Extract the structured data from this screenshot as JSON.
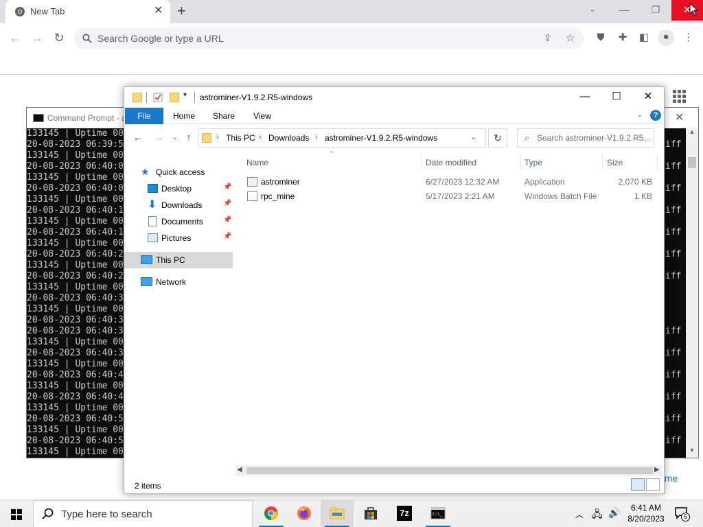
{
  "browser": {
    "tab_title": "New Tab",
    "tab_close": "✕",
    "new_tab": "+",
    "omnibox_placeholder": "Search Google or type a URL",
    "win_min": "—",
    "win_restore": "❐",
    "win_close": "✕",
    "home_link_fragment": "ome"
  },
  "cmd": {
    "title": "Command Prompt - a",
    "lines": [
      "133145 | Uptime 00",
      "20-08-2023 06:39:5",
      "133145 | Uptime 00",
      "20-08-2023 06:40:0",
      "133145 | Uptime 00",
      "20-08-2023 06:40:0",
      "133145 | Uptime 00",
      "20-08-2023 06:40:1",
      "133145 | Uptime 00",
      "20-08-2023 06:40:1",
      "133145 | Uptime 00",
      "20-08-2023 06:40:2",
      "133145 | Uptime 00",
      "20-08-2023 06:40:2",
      "133145 | Uptime 00",
      "20-08-2023 06:40:3",
      "133145 | Uptime 00",
      "20-08-2023 06:40:3",
      "20-08-2023 06:40:3",
      "133145 | Uptime 00",
      "20-08-2023 06:40:3",
      "133145 | Uptime 00",
      "20-08-2023 06:40:4",
      "133145 | Uptime 00",
      "20-08-2023 06:40:4",
      "133145 | Uptime 00",
      "20-08-2023 06:40:5",
      "133145 | Uptime 00",
      "20-08-2023 06:40:5",
      "133145 | Uptime 00"
    ],
    "right_fragments": [
      "",
      "iff",
      "",
      "iff",
      "",
      "iff",
      "",
      "iff",
      "",
      "iff",
      "",
      "iff",
      "",
      "iff",
      "",
      "",
      "",
      "",
      "iff",
      "",
      "iff",
      "",
      "iff",
      "",
      "iff",
      "",
      "iff",
      "",
      "iff"
    ]
  },
  "explorer": {
    "title": "astrominer-V1.9.2.R5-windows",
    "win_min": "—",
    "win_max": "☐",
    "win_close": "✕",
    "ribbon_tabs": [
      "File",
      "Home",
      "Share",
      "View"
    ],
    "help": "?",
    "breadcrumb": [
      "This PC",
      "Downloads",
      "astrominer-V1.9.2.R5-windows"
    ],
    "search_placeholder": "Search astrominer-V1.9.2.R5...",
    "nav": {
      "quick_access": "Quick access",
      "desktop": "Desktop",
      "downloads": "Downloads",
      "documents": "Documents",
      "pictures": "Pictures",
      "this_pc": "This PC",
      "network": "Network"
    },
    "columns": {
      "name": "Name",
      "date": "Date modified",
      "type": "Type",
      "size": "Size"
    },
    "files": [
      {
        "name": "astrominer",
        "date": "6/27/2023 12:32 AM",
        "type": "Application",
        "size": "2,070 KB"
      },
      {
        "name": "rpc_mine",
        "date": "5/17/2023 2:21 AM",
        "type": "Windows Batch File",
        "size": "1 KB"
      }
    ],
    "status_count": "2 items",
    "colors": {
      "accent": "#1979ca",
      "folder": "#f8d775"
    }
  },
  "taskbar": {
    "search_placeholder": "Type here to search",
    "time": "6:41 AM",
    "date": "8/20/2023",
    "notification_count": "5",
    "apps": [
      "chrome-icon",
      "firefox-icon",
      "file-explorer-icon",
      "store-icon",
      "7zip-icon",
      "cmd-icon"
    ],
    "seven_zip_label": "7z"
  }
}
